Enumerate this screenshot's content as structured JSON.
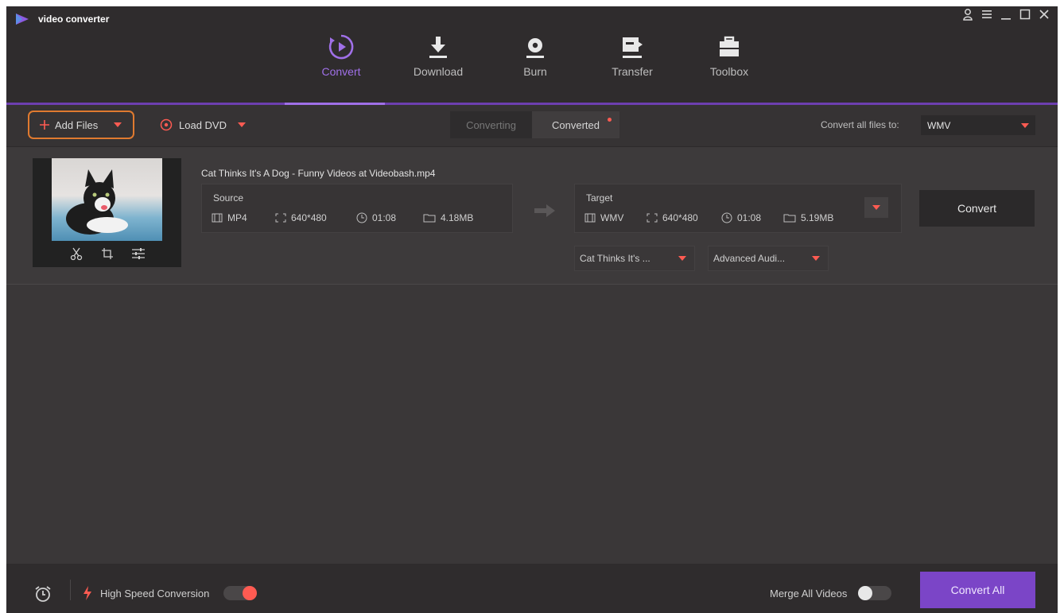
{
  "app": {
    "name": "video converter"
  },
  "window_controls": [
    "user-icon",
    "menu-icon",
    "minimize-icon",
    "maximize-icon",
    "close-icon"
  ],
  "nav": {
    "items": [
      {
        "label": "Convert",
        "icon": "convert-icon",
        "active": true
      },
      {
        "label": "Download",
        "icon": "download-icon",
        "active": false
      },
      {
        "label": "Burn",
        "icon": "burn-icon",
        "active": false
      },
      {
        "label": "Transfer",
        "icon": "transfer-icon",
        "active": false
      },
      {
        "label": "Toolbox",
        "icon": "toolbox-icon",
        "active": false
      }
    ]
  },
  "toolbar": {
    "add_files": "Add Files",
    "load_dvd": "Load DVD",
    "tabs": [
      {
        "label": "Converting",
        "active": false
      },
      {
        "label": "Converted",
        "active": true,
        "has_dot": true
      }
    ],
    "convert_all_label": "Convert all files to:",
    "format_value": "WMV"
  },
  "file": {
    "title": "Cat Thinks It's A Dog - Funny Videos at Videobash.mp4",
    "source": {
      "label": "Source",
      "format": "MP4",
      "resolution": "640*480",
      "duration": "01:08",
      "size": "4.18MB"
    },
    "target": {
      "label": "Target",
      "format": "WMV",
      "resolution": "640*480",
      "duration": "01:08",
      "size": "5.19MB"
    },
    "convert_label": "Convert",
    "subtitle_value": "Cat Thinks It's ...",
    "audio_value": "Advanced Audi..."
  },
  "bottom": {
    "high_speed_label": "High Speed Conversion",
    "high_speed_on": true,
    "merge_label": "Merge All Videos",
    "merge_on": false,
    "convert_all_button": "Convert All"
  },
  "colors": {
    "accent_purple": "#7b45c7",
    "active_nav": "#a070e8",
    "highlight_orange": "#e07a2f",
    "dropdown_red": "#ff5b52"
  }
}
